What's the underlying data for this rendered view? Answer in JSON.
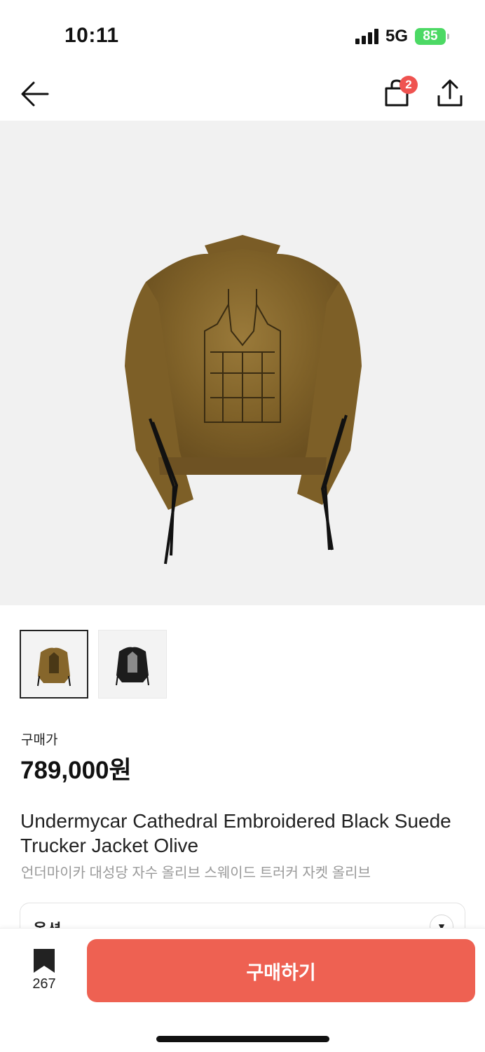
{
  "status_bar": {
    "time": "10:11",
    "network": "5G",
    "battery": "85"
  },
  "nav": {
    "cart_badge": "2",
    "icons": [
      "back-arrow-icon",
      "shopping-bag-icon",
      "share-icon"
    ]
  },
  "gallery": {
    "images": [
      "olive-suede-jacket",
      "black-suede-jacket"
    ],
    "selected_index": 0
  },
  "product": {
    "price_label": "구매가",
    "price": "789,000원",
    "title_en": "Undermycar Cathedral Embroidered Black Suede Trucker Jacket Olive",
    "title_ko": "언더마이카 대성당 자수 올리브 스웨이드 트러커 자켓 올리브"
  },
  "option": {
    "label": "옵션"
  },
  "bottom": {
    "bookmark_count": "267",
    "buy_label": "구매하기"
  },
  "colors": {
    "accent": "#ee6152",
    "badge": "#ef5350",
    "battery": "#4cd964",
    "jacket_olive": "#8a6a2e",
    "jacket_black": "#1c1c1c"
  }
}
